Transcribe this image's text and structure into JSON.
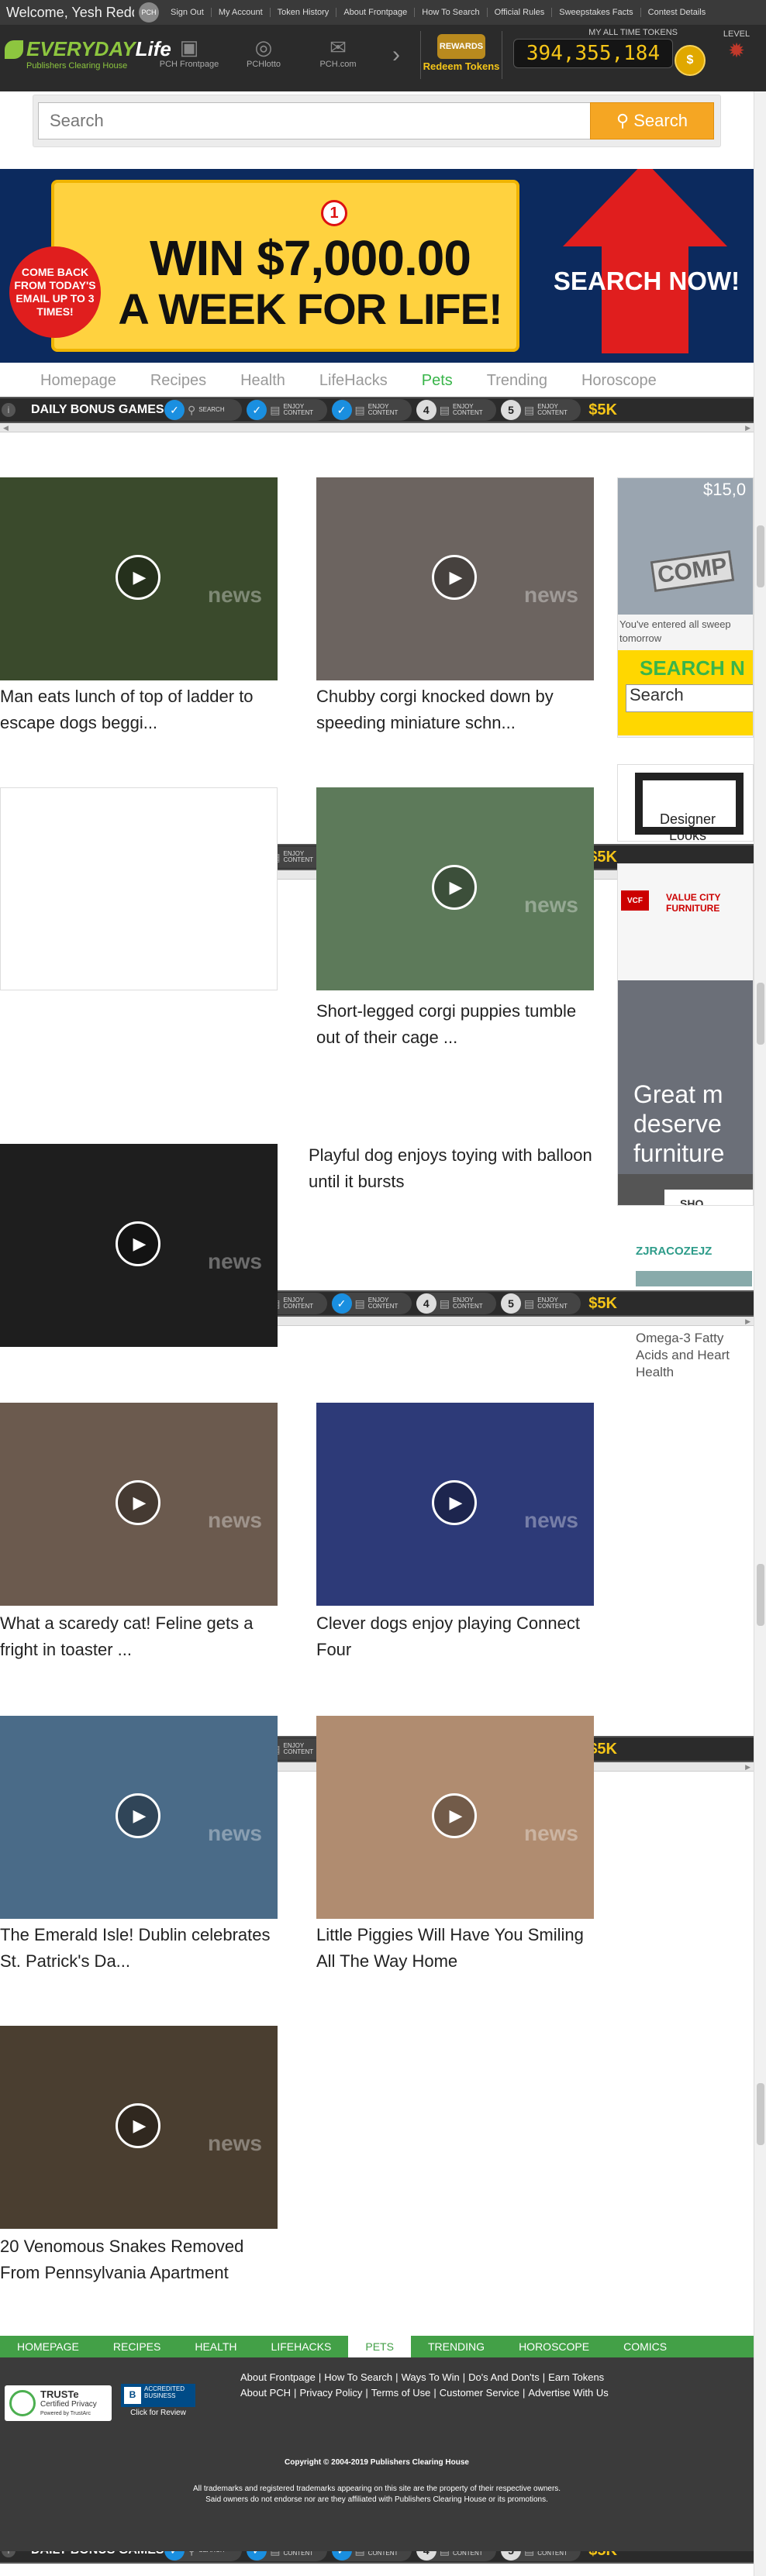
{
  "topbar": {
    "welcome": "Welcome, Yesh Redd",
    "avatar": "PCH",
    "links": [
      "Sign Out",
      "My Account",
      "Token History",
      "About Frontpage",
      "How To Search",
      "Official Rules",
      "Sweepstakes Facts",
      "Contest Details"
    ]
  },
  "header": {
    "logo_main": "EVERYDAY",
    "logo_life": "Life",
    "logo_sub": "Publishers Clearing House",
    "sites": [
      "PCH Frontpage",
      "PCHlotto",
      "PCH.com"
    ],
    "rewards_badge": "REWARDS",
    "rewards_label": "Redeem Tokens",
    "tokens_label": "MY ALL TIME TOKENS",
    "tokens_value": "394,355,184",
    "level_label": "LEVEL"
  },
  "search": {
    "placeholder": "Search",
    "button": "Search"
  },
  "banner": {
    "number": "1",
    "line1": "WIN $7,000.00",
    "line2": "A WEEK FOR LIFE!",
    "burst": "COME BACK FROM TODAY'S EMAIL UP TO 3 TIMES!",
    "cta": "SEARCH NOW!"
  },
  "nav": {
    "items": [
      "Homepage",
      "Recipes",
      "Health",
      "LifeHacks",
      "Pets",
      "Trending",
      "Horoscope"
    ]
  },
  "bonus": {
    "title": "DAILY BONUS GAMES",
    "tasks": [
      {
        "type": "check",
        "label": "SEARCH"
      },
      {
        "type": "check",
        "label": "ENJOY CONTENT"
      },
      {
        "type": "check",
        "label": "ENJOY CONTENT"
      },
      {
        "type": "num",
        "num": "4",
        "label": "ENJOY CONTENT"
      },
      {
        "type": "num",
        "num": "5",
        "label": "ENJOY CONTENT"
      }
    ],
    "prize": "$5K"
  },
  "videos": [
    {
      "title": "Man eats lunch of top of ladder to escape dogs beggi..."
    },
    {
      "title": "Chubby corgi knocked down by speeding miniature schn..."
    },
    {
      "title": ""
    },
    {
      "title": "Short-legged corgi puppies tumble out of their cage ..."
    },
    {
      "title": ""
    },
    {
      "title": "Playful dog enjoys toying with balloon until it bursts"
    },
    {
      "title": "What a scaredy cat! Feline gets a fright in toaster ..."
    },
    {
      "title": "Clever dogs enjoy playing Connect Four"
    },
    {
      "title": "The Emerald Isle! Dublin celebrates St. Patrick's Da..."
    },
    {
      "title": "Little Piggies Will Have You Smiling All The Way Home"
    },
    {
      "title": "20 Venomous Snakes Removed From Pennsylvania Apartment"
    }
  ],
  "watermark": "news",
  "rail": {
    "ad1_amount": "$15,0",
    "ad1_stamp": "COMP",
    "ad1_text": "You've entered all sweep tomorrow",
    "ad1_cta": "SEARCH N",
    "ad1_search": "Search",
    "ad2_text": "Designer Looks",
    "ad3_brand": "VALUE CITY FURNITURE",
    "ad3_text": "Great m deserve furniture",
    "ad3_btn": "SHO",
    "ad4_brand": "ZJRACOZEJZ",
    "ad4_text": "Omega-3 Fatty Acids and Heart Health"
  },
  "footer": {
    "nav": [
      "HOMEPAGE",
      "RECIPES",
      "HEALTH",
      "LIFEHACKS",
      "PETS",
      "TRENDING",
      "HOROSCOPE",
      "COMICS"
    ],
    "links1": [
      "About Frontpage",
      "How To Search",
      "Ways To Win",
      "Do's And Don'ts",
      "Earn Tokens"
    ],
    "links2": [
      "About PCH",
      "Privacy Policy",
      "Terms of Use",
      "Customer Service",
      "Advertise With Us"
    ],
    "truste_title": "TRUSTe",
    "truste_sub": "Certified Privacy",
    "truste_by": "Powered by TrustArc",
    "bbb_text": "ACCREDITED BUSINESS",
    "bbb_label": "Click for Review",
    "copyright": "Copyright © 2004-2019 Publishers Clearing House",
    "trademark1": "All trademarks and registered trademarks appearing on this site are the property of their respective owners.",
    "trademark2": "Said owners do not endorse nor are they affiliated with Publishers Clearing House or its promotions."
  }
}
